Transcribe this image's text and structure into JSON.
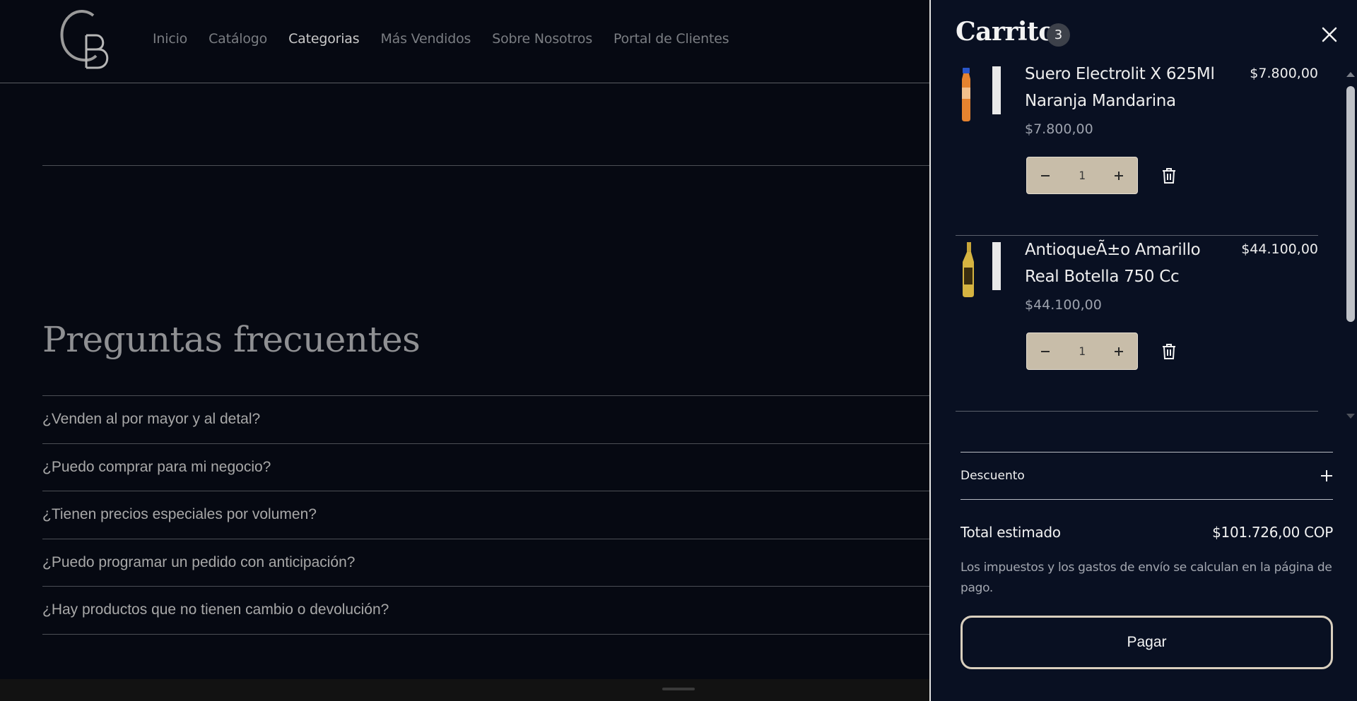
{
  "brand": {
    "logo_text": "CB"
  },
  "nav": {
    "items": [
      {
        "label": "Inicio",
        "active": false
      },
      {
        "label": "Catálogo",
        "active": false
      },
      {
        "label": "Categorias",
        "active": true
      },
      {
        "label": "Más Vendidos",
        "active": false
      },
      {
        "label": "Sobre Nosotros",
        "active": false
      },
      {
        "label": "Portal de Clientes",
        "active": false
      }
    ]
  },
  "faq": {
    "title": "Preguntas frecuentes",
    "questions": [
      "¿Venden al por mayor y al detal?",
      "¿Puedo comprar para mi negocio?",
      "¿Tienen precios especiales por volumen?",
      "¿Puedo programar un pedido con anticipación?",
      "¿Hay productos que no tienen cambio o devolución?"
    ]
  },
  "cart": {
    "title": "Carrito",
    "count": "3",
    "items": [
      {
        "name": "Suero Electrolit X 625Ml Naranja Mandarina",
        "total": "$7.800,00",
        "unit_price": "$7.800,00",
        "quantity": "1",
        "thumb_icon": "orange-bottle-image"
      },
      {
        "name": "AntioqueÃ±o Amarillo Real Botella 750 Cc",
        "total": "$44.100,00",
        "unit_price": "$44.100,00",
        "quantity": "1",
        "thumb_icon": "yellow-bottle-image"
      }
    ],
    "discount_label": "Descuento",
    "total_label": "Total estimado",
    "total_value": "$101.726,00 COP",
    "tax_note": "Los impuestos y los gastos de envío se calculan en la página de pago.",
    "pay_label": "Pagar"
  },
  "colors": {
    "page_bg": "#060912",
    "drawer_bg": "#091022",
    "quantity_bg": "#c8bda9",
    "accent_border": "#d9cfbe"
  }
}
